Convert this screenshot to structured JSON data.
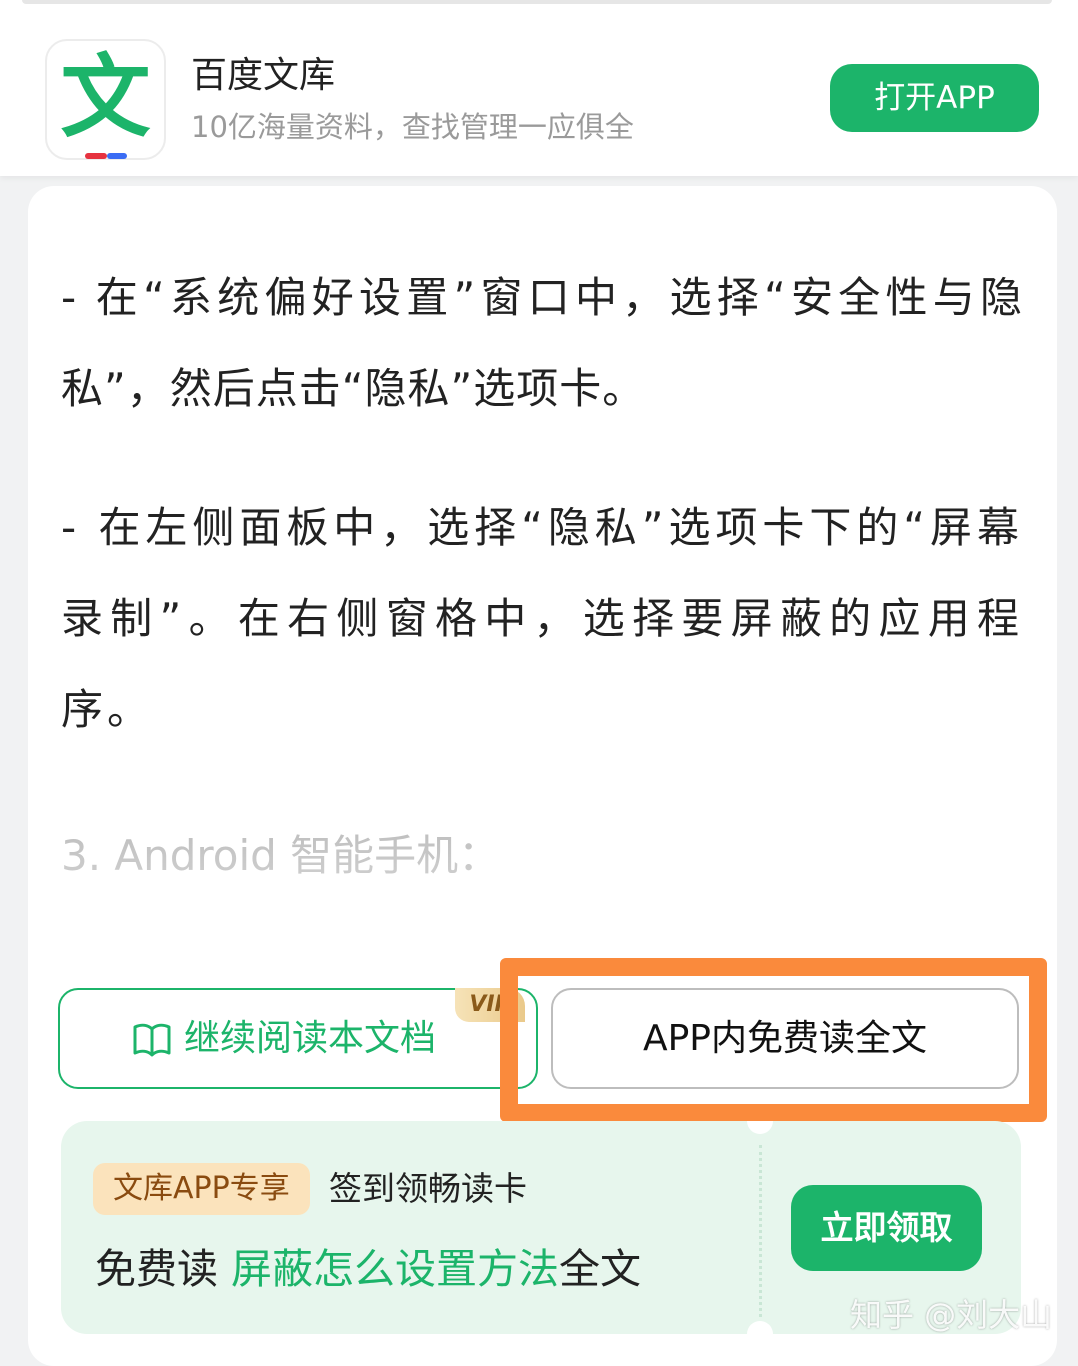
{
  "top_bar": {
    "app_icon_glyph": "文",
    "app_name": "百度文库",
    "app_description": "10亿海量资料，查找管理一应俱全",
    "open_button": "打开APP"
  },
  "article": {
    "paragraphs": [
      " - 在“系统偏好设置”窗口中，选择“安全性与隐私”，然后点击“隐私”选项卡。",
      " - 在左侧面板中，选择“隐私”选项卡下的“屏幕录制”。在右侧窗格中，选择要屏蔽的应用程序。"
    ],
    "faded_line": "3. Android 智能手机："
  },
  "actions": {
    "continue_label": "继续阅读本文档",
    "vip_badge": "VIP",
    "free_read_label": "APP内免费读全文",
    "highlight_color": "#fa8a3c"
  },
  "promo": {
    "tag": "文库APP专享",
    "subtitle": "签到领畅读卡",
    "prefix": "免费读 ",
    "title_highlight": "屏蔽怎么设置方法",
    "suffix": "全文",
    "claim_button": "立即领取"
  },
  "watermark": "知乎 @刘大山",
  "colors": {
    "brand_green": "#1cb46a",
    "promo_background": "#e7f6ed",
    "tag_background": "#fbe3bc"
  }
}
